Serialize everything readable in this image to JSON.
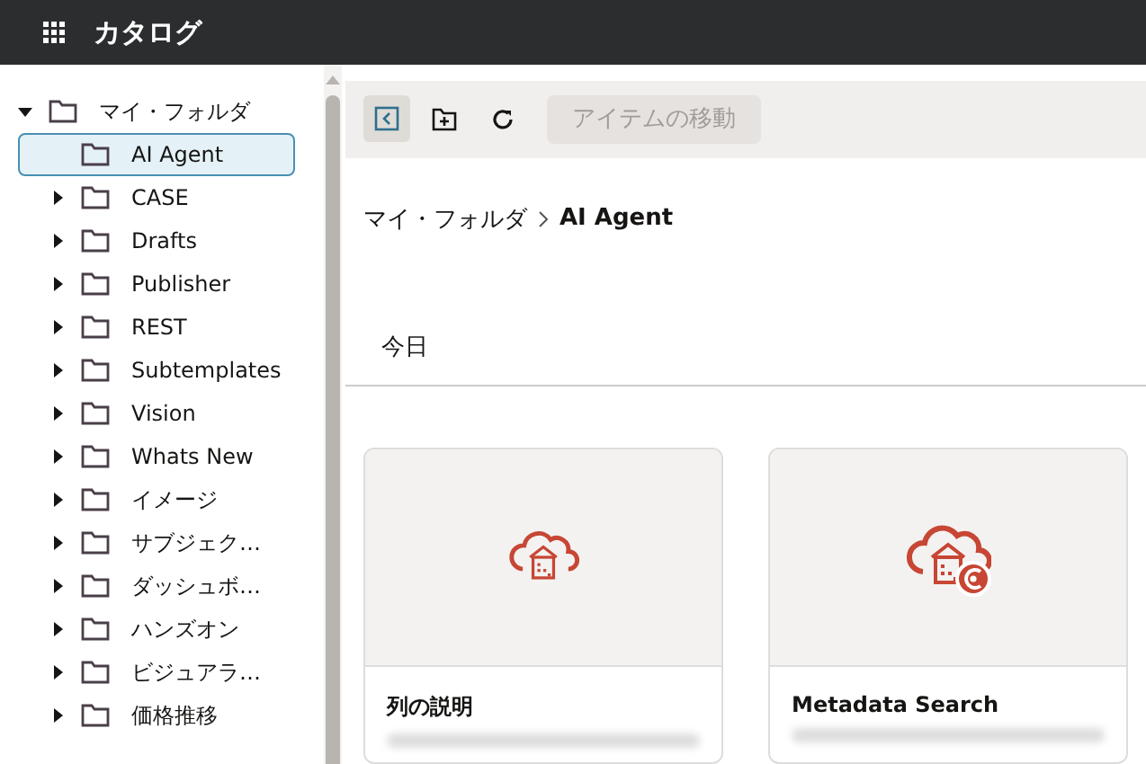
{
  "header": {
    "title": "カタログ"
  },
  "tree": [
    {
      "label": "マイ・フォルダ",
      "kind": "branch",
      "expanded": true,
      "selected": false,
      "children": [
        {
          "label": "AI Agent",
          "kind": "leaf",
          "selected": true
        },
        {
          "label": "CASE",
          "kind": "branch",
          "expanded": false,
          "selected": false
        },
        {
          "label": "Drafts",
          "kind": "branch",
          "expanded": false,
          "selected": false
        },
        {
          "label": "Publisher",
          "kind": "branch",
          "expanded": false,
          "selected": false
        },
        {
          "label": "REST",
          "kind": "branch",
          "expanded": false,
          "selected": false
        },
        {
          "label": "Subtemplates",
          "kind": "branch",
          "expanded": false,
          "selected": false
        },
        {
          "label": "Vision",
          "kind": "branch",
          "expanded": false,
          "selected": false
        },
        {
          "label": "Whats New",
          "kind": "branch",
          "expanded": false,
          "selected": false
        },
        {
          "label": "イメージ",
          "kind": "branch",
          "expanded": false,
          "selected": false
        },
        {
          "label": "サブジェク…",
          "kind": "branch",
          "expanded": false,
          "selected": false
        },
        {
          "label": "ダッシュボ…",
          "kind": "branch",
          "expanded": false,
          "selected": false
        },
        {
          "label": "ハンズオン",
          "kind": "branch",
          "expanded": false,
          "selected": false
        },
        {
          "label": "ビジュアラ…",
          "kind": "branch",
          "expanded": false,
          "selected": false
        },
        {
          "label": "価格推移",
          "kind": "branch",
          "expanded": false,
          "selected": false
        }
      ]
    }
  ],
  "toolbar": {
    "move_button": {
      "label": "アイテムの移動",
      "disabled": true
    }
  },
  "breadcrumb": [
    {
      "label": "マイ・フォルダ"
    },
    {
      "label": "AI Agent"
    }
  ],
  "tabs": [
    {
      "label": "今日",
      "selected": false
    }
  ],
  "cards": [
    {
      "title": "列の説明",
      "kind": "plain"
    },
    {
      "title": "Metadata Search",
      "kind": "badge"
    }
  ]
}
